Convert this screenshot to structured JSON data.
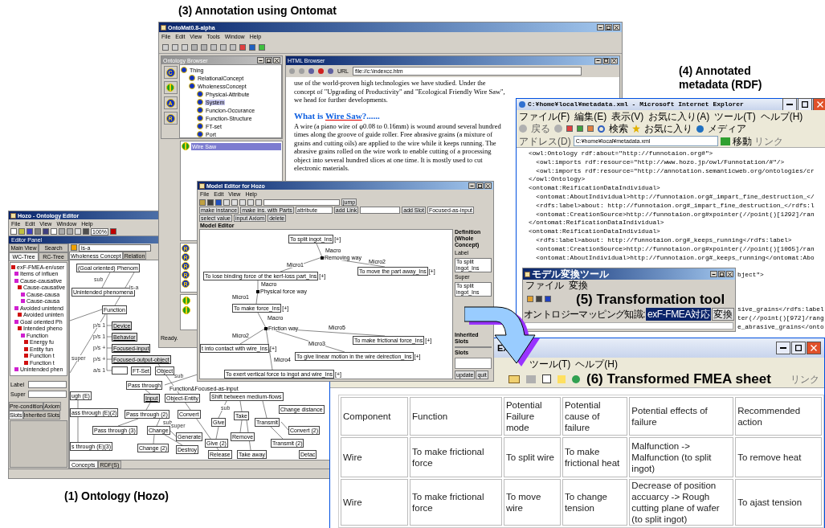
{
  "captions": {
    "ontomat": "(3) Annotation using Ontomat",
    "rdf": "(4) Annotated metadata (RDF)",
    "hozo": "(1) Ontology (Hozo)"
  },
  "hozo": {
    "title": "Hozo - Ontology Editor",
    "menu": [
      "File",
      "Edit",
      "View",
      "Window",
      "Help"
    ],
    "zoom": "100%",
    "panel_title": "Editor Panel",
    "view_tabs": [
      {
        "label": "Main View",
        "selected": false
      },
      {
        "label": "Search",
        "selected": false
      },
      {
        "label": "WC-Tree",
        "selected": true
      },
      {
        "label": "RC-Tree",
        "selected": false
      }
    ],
    "tree": [
      {
        "label": "exF-FMEA-en/user",
        "children": [
          {
            "label": "Items of influen"
          },
          {
            "label": "Cause-causative",
            "children": [
              {
                "label": "Cause-causative",
                "children": [
                  {
                    "label": "Cause-causa"
                  },
                  {
                    "label": "Cause-causa"
                  }
                ]
              }
            ]
          },
          {
            "label": "Avoided unintend",
            "children": [
              {
                "label": "Avoided uninten"
              }
            ]
          },
          {
            "label": "Goal oriented Ph",
            "children": [
              {
                "label": "Intended pheno",
                "children": [
                  {
                    "label": "Function",
                    "children": [
                      {
                        "label": "Energy fu"
                      },
                      {
                        "label": "Entity fun"
                      },
                      {
                        "label": "Function t"
                      },
                      {
                        "label": "Function t"
                      }
                    ]
                  }
                ]
              }
            ]
          },
          {
            "label": "Unintended phen"
          }
        ]
      }
    ],
    "fields": [
      "Label",
      "Super"
    ],
    "slot_tabs": [
      {
        "label": "Pre-condition",
        "selected": false
      },
      {
        "label": "Axiom",
        "selected": false
      },
      {
        "label": "Slots",
        "selected": true
      },
      {
        "label": "Inherited Slots",
        "selected": false
      }
    ],
    "link_type": "is-a",
    "canvas_tabs": [
      {
        "label": "Wholeness Concept",
        "selected": true
      },
      {
        "label": "Relation",
        "selected": false
      }
    ],
    "nodes": [
      {
        "label": "(Goal oriented) Phenom",
        "kind": "concept"
      },
      {
        "label": "Unintended phenomena",
        "kind": "concept"
      },
      {
        "label": "Function",
        "kind": "concept"
      },
      {
        "label": "Device",
        "kind": "role"
      },
      {
        "label": "Behavior",
        "kind": "role"
      },
      {
        "label": "Focused-input",
        "kind": "role"
      },
      {
        "label": "Focused-output-object",
        "kind": "role"
      },
      {
        "kind": "blank"
      },
      {
        "label": "FT-Set",
        "kind": "concept"
      },
      {
        "label": "Object",
        "kind": "concept"
      },
      {
        "label": "Pass through",
        "kind": "concept"
      },
      {
        "label": "Function&Focused-as-input",
        "kind": "label"
      },
      {
        "label": "ugh (E)",
        "kind": "concept"
      },
      {
        "label": "Shift between medium-flows",
        "kind": "concept"
      },
      {
        "label": "Input",
        "kind": "role"
      },
      {
        "label": "Object-Entity",
        "kind": "concept"
      },
      {
        "label": "Change distance",
        "kind": "concept"
      },
      {
        "label": "ass through (E)(2)",
        "kind": "concept"
      },
      {
        "label": "Pass through (2)",
        "kind": "concept"
      },
      {
        "label": "Convert",
        "kind": "concept"
      },
      {
        "label": "Take",
        "kind": "concept"
      },
      {
        "label": "Give",
        "kind": "concept"
      },
      {
        "label": "Transmit",
        "kind": "concept"
      },
      {
        "label": "Pass through (3)",
        "kind": "concept"
      },
      {
        "label": "Change",
        "kind": "concept"
      },
      {
        "label": "Convert (2)",
        "kind": "concept"
      },
      {
        "label": "Generate",
        "kind": "concept"
      },
      {
        "label": "Remove",
        "kind": "concept"
      },
      {
        "label": "Give (2)",
        "kind": "concept"
      },
      {
        "label": "Transmit (2)",
        "kind": "concept"
      },
      {
        "label": "s through (E)(3)",
        "kind": "concept"
      },
      {
        "label": "Change (2)",
        "kind": "concept"
      },
      {
        "label": "Destroy",
        "kind": "concept"
      },
      {
        "label": "Release",
        "kind": "concept"
      },
      {
        "label": "Take away",
        "kind": "concept"
      },
      {
        "label": "Detac",
        "kind": "concept"
      }
    ],
    "edge_labels": [
      "sub",
      "is-a",
      "p/s 1",
      "p/s 1",
      "p/s +",
      "super",
      "p/s +",
      "a/s 1",
      "sub",
      "sub",
      "sub",
      "super"
    ],
    "bottom_tabs": [
      {
        "label": "Concepts",
        "selected": true
      },
      {
        "label": "RDF(S)",
        "selected": false
      }
    ]
  },
  "ontomat": {
    "title": "OntoMat0.8-alpha",
    "menu": [
      "File",
      "Edit",
      "View",
      "Tools",
      "Window",
      "Help"
    ],
    "browser_title": "Ontology Browser",
    "mode_buttons": [
      {
        "kind": "concept",
        "glyph": "C"
      },
      {
        "kind": "instance"
      },
      {
        "kind": "attribute",
        "glyph": "A"
      },
      {
        "kind": "relation",
        "glyph": "R"
      }
    ],
    "tree": [
      {
        "label": "Thing",
        "selected": false,
        "children": [
          {
            "label": "RelationalConcept",
            "selected": false
          },
          {
            "label": "WholenessConcept",
            "selected": false,
            "children": [
              {
                "label": "Physical-Attribute",
                "selected": false
              },
              {
                "label": "System",
                "selected": true
              },
              {
                "label": "Funcion-Occurance",
                "selected": false
              },
              {
                "label": "Function-Structure",
                "selected": false
              },
              {
                "label": "FT-set",
                "selected": false
              },
              {
                "label": "Port",
                "selected": false
              }
            ]
          }
        ]
      }
    ],
    "instances": [
      {
        "label": "Wire Saw",
        "selected": true
      }
    ],
    "relation_rows": [
      "R",
      "R",
      "R",
      "R",
      "R"
    ],
    "status": "Ready.",
    "html": {
      "title": "HTML Browser",
      "url_label": "URL",
      "url": "file://c:\\indexcc.htm",
      "intro": "use of the world-proven high technologies we have studied. Under the concept of \"Upgrading of Productivity\" and \"Ecological Friendly Wire Saw\", we head for further developments.",
      "heading": [
        "What is ",
        "Wire Saw",
        "?......"
      ],
      "body": "A wire (a piano wire of φ0.08 to 0.16mm) is wound around several hundred times along the groove of guide roller. Free abrasive grains (a mixture of grains and cutting oils) are applied to the wire while it keeps running. The abrasive grains rolled on the wire work to enable cutting of a processing object into several hundred slices at one time. It is mostly used to cut electronic materials."
    }
  },
  "rdf_window": {
    "title": "C:¥home¥local¥metadata.xml - Microsoft Internet Explorer",
    "menu": [
      "ファイル(F)",
      "編集(E)",
      "表示(V)",
      "お気に入り(A)",
      "ツール(T)",
      "ヘルプ(H)"
    ],
    "back": "戻る",
    "search": "検索",
    "favorites": "お気に入り",
    "media": "メディア",
    "address_label": "アドレス(D)",
    "address": "C:¥home¥local¥metadata.xml",
    "go": "移動",
    "links": "リンク",
    "lines": [
      "<owl:Ontology rdf:about=\"http://funnotaion.org#\">",
      "  <owl:imports rdf:resource=\"http://www.hozo.jp/owl/Funnotation/#\"/>",
      "  <owl:imports rdf:resource=\"http://annotation.semanticweb.org/ontologies/cr",
      "</owl:Ontology>",
      "<ontomat:ReificationDataIndividual>",
      "  <ontomat:AboutIndividual>http://funnotaion.org#_impart_fine_destruction_</",
      "  <rdfs:label>about: http://funnotaion.org#_impart_fine_destruction_</rdfs:l",
      "  <ontomat:CreationSource>http://funnotaion.org#xpointer(//point()[1292]/ran",
      "</ontomat:ReificationDataIndividual>",
      "<ontomat:ReificationDataIndividual>",
      "  <rdfs:label>about: http://funnotaion.org#_keeps_running</rdfs:label>",
      "  <ontomat:CreationSource>http://funnotaion.org#xpointer(//point()[1065]/ran",
      "  <ontomat:AboutIndividual>http://funnotaion.org#_keeps_running</ontomat:Abo"
    ],
    "fragments": [
      "bject\">",
      "sive_grains</rdfs:label",
      "ter(//point()[972]/rang",
      "e_abrasive_grains</onto"
    ]
  },
  "model_editor": {
    "title": "Model Editor for Hozo",
    "menu": [
      "File",
      "Edit",
      "View",
      "Help"
    ],
    "jump": "jump",
    "actions": [
      "make instance",
      "make ins. with Parts"
    ],
    "attribute": "attribute",
    "add_link": "add Link",
    "add_slot": "add Slot",
    "slot_value": "Focused-as-input",
    "tail_actions": [
      "select value",
      "input Axiom",
      "delete"
    ],
    "panel_label": "Model Editor",
    "nodes": [
      {
        "label": "To split ingot_Ins",
        "expander": "[+]"
      },
      {
        "label": "To move the part away_Ins",
        "expander": "[+]"
      },
      {
        "label": "To lose binding force of the kerf-loss part_Ins",
        "expander": "[+]"
      },
      {
        "label": "To make force_Ins",
        "expander": "[+]"
      },
      {
        "label": "To make frictional force_Ins",
        "expander": "[+]"
      },
      {
        "label": "t into contact with wire_Ins",
        "expander": "[+]"
      },
      {
        "label": "To give linear motion in the wire deirection_Ins",
        "expander": "[+]"
      },
      {
        "label": "To exert vertical force to ingot and wire_Ins",
        "expander": "[+]"
      }
    ],
    "junctions": [
      "Removing way",
      "Physical force way",
      "Friction way"
    ],
    "edge_labels": [
      "Macro",
      "Micro2",
      "Micro1",
      "Macro",
      "Micro1",
      "Macro",
      "Micro5",
      "Micro2",
      "Micro3",
      "Micro4"
    ],
    "side": {
      "title": "Definition (Whole Concept)",
      "label_caption": "Label",
      "label_value": "To split ingot_Ins",
      "super_caption": "Super",
      "super_value": "To split ingot_Ins",
      "inherited": "Inherited Slots",
      "slots": "Slots",
      "buttons": [
        "update",
        "quit"
      ]
    }
  },
  "tool": {
    "title": "モデル変換ツール",
    "menu": [
      "ファイル",
      "変換"
    ],
    "caption": "(5) Transformation tool",
    "mapping_label": "オントロジーマッピング知識:",
    "mapping_value": "exF-FMEA対応",
    "convert": "変換"
  },
  "fmea_window": {
    "title": "Ex",
    "menu": [
      "ツール(T)",
      "ヘルプ(H)"
    ],
    "caption": "(6) Transformed FMEA sheet",
    "links": "リンク",
    "columns": [
      "Component",
      "Function",
      "Potential Failure mode",
      "Potential cause of failure",
      "Potential effects of failure",
      "Recommended action"
    ],
    "rows": [
      [
        "Wire",
        "To make frictional force",
        "To split wire",
        "To make frictional heat",
        "Malfunction -> Malfunction (to split ingot)",
        "To remove heat"
      ],
      [
        "Wire",
        "To make frictional force",
        "To move wire",
        "To change tension",
        "Decrease of position accuarcy   -> Rough cutting plane of wafer (to split ingot)",
        "To ajast tension"
      ]
    ]
  }
}
